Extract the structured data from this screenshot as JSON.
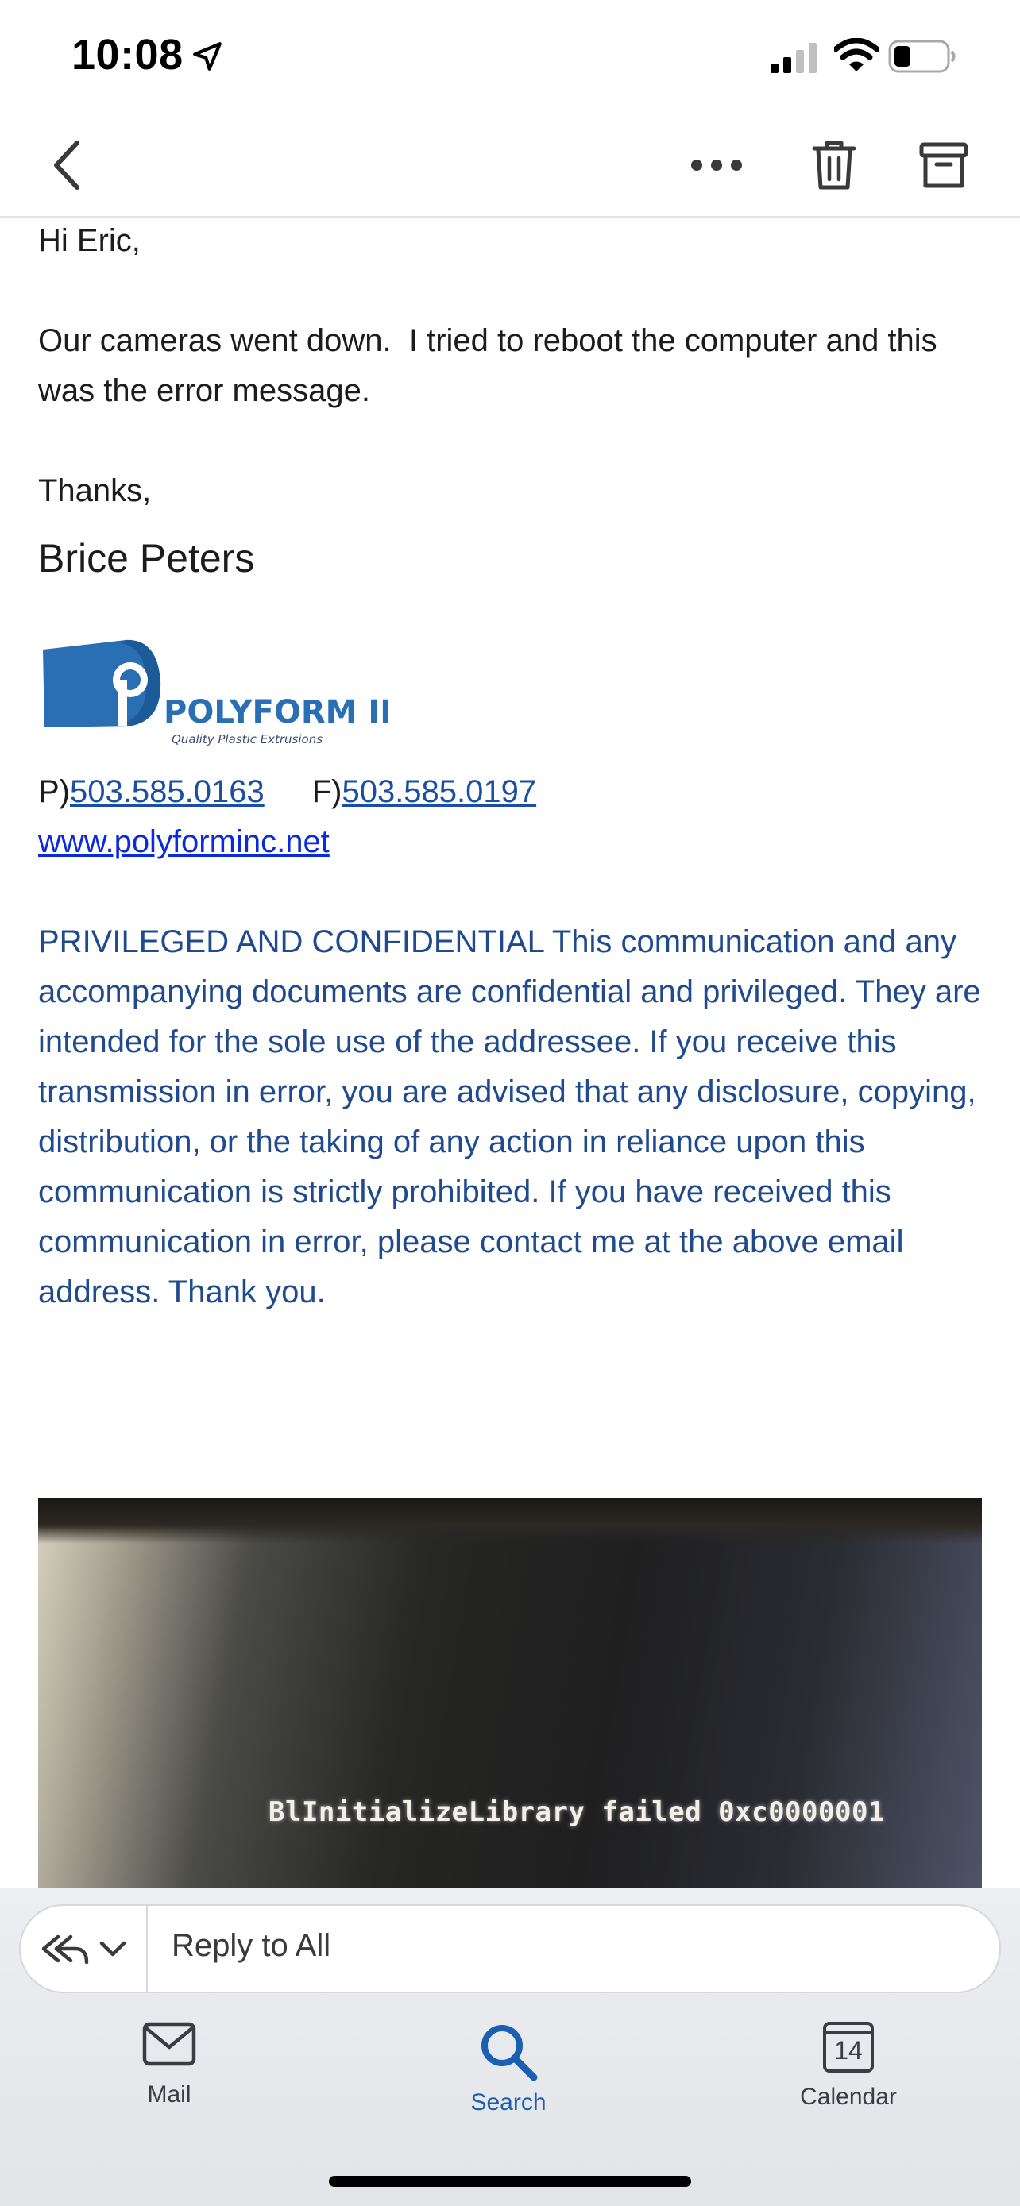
{
  "status_bar": {
    "time": "10:08",
    "icons": [
      "location-arrow-icon",
      "cellular-signal-icon",
      "wifi-icon",
      "battery-icon"
    ]
  },
  "toolbar": {
    "icons": [
      "chevron-left-icon",
      "ellipsis-icon",
      "trash-icon",
      "archive-icon"
    ]
  },
  "email": {
    "greeting": "Hi Eric,",
    "body": "Our cameras went down.  I tried to reboot the computer and this was the error message.",
    "closing": "Thanks,",
    "sender_name": "Brice Peters",
    "logo": {
      "name": "POLYFORM INC.",
      "tagline": "Quality Plastic Extrusions",
      "color": "#2a6fb4"
    },
    "phone_prefix": "P)",
    "phone": "503.585.0163",
    "fax_prefix": "F)",
    "fax": "503.585.0197",
    "website": "www.polyforminc.net",
    "disclaimer": "PRIVILEGED AND CONFIDENTIAL This communication and any accompanying documents are confidential and privileged. They are intended for the sole use of the addressee. If you receive this transmission in error, you are advised that any disclosure, copying, distribution, or the taking of any action in reliance upon this communication is strictly prohibited. If you have received this communication in error, please contact me at the above email address. Thank you.",
    "disclaimer_color": "#1f4b8e",
    "attachment_text": "BlInitializeLibrary failed 0xc0000001"
  },
  "reply_bar": {
    "label": "Reply to All",
    "icons": [
      "reply-all-icon",
      "chevron-down-icon"
    ]
  },
  "tab_bar": {
    "tabs": [
      {
        "label": "Mail",
        "icon": "mail-icon"
      },
      {
        "label": "Search",
        "icon": "search-icon",
        "active": true
      },
      {
        "label": "Calendar",
        "icon": "calendar-icon",
        "day": "14"
      }
    ],
    "active_color": "#1b5fb0"
  }
}
